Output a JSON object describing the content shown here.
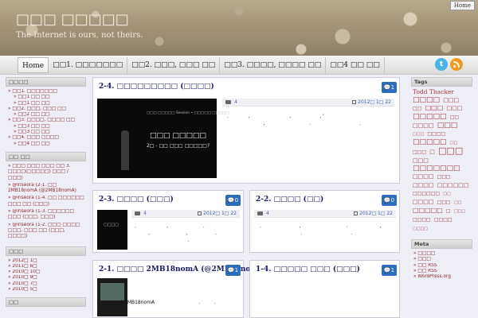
{
  "header": {
    "site_title": "□□□ □□□□□",
    "tagline": "The Internet is ours, not theirs.",
    "home_button": "Home"
  },
  "nav": {
    "items": [
      "Home",
      "□□1. □□□□□□□",
      "□□2. □□□, □□□ □□",
      "□□3. □□□□, □□□□ □□",
      "□□4 □□ □□"
    ],
    "twitter_icon": "twitter-icon",
    "rss_icon": "rss-icon"
  },
  "sidebar_left": {
    "categories": {
      "title": "□□□□",
      "items": [
        {
          "label": "□□1. □□□□□□□",
          "sub": false
        },
        {
          "label": "□□1 □□ □□",
          "sub": true
        },
        {
          "label": "□□1 □□ □□",
          "sub": true
        },
        {
          "label": "□□2. □□□, □□□ □□",
          "sub": false
        },
        {
          "label": "□□2 □□ □□",
          "sub": true
        },
        {
          "label": "□□3. □□□□, □□□□ □□",
          "sub": false
        },
        {
          "label": "□□3 □□ □□",
          "sub": true
        },
        {
          "label": "□□3 □□ □□",
          "sub": true
        },
        {
          "label": "□□4. □□□ □□□□",
          "sub": false
        },
        {
          "label": "□□4 □□ □□",
          "sub": true
        }
      ]
    },
    "recent_comments": {
      "title": "□□ □□",
      "items": [
        "□□□ □□□ □□□ □□ 3. □□□□(□□□□□) □□□ / □□□)",
        "@iriseora (2-1. □□ 2MB18nomA (@2MB18nomA)",
        "@iriseora (1-4. □□ □□□□□□ □□□ □□ (□□□)",
        "@iriseora (1-3. □□□□□□ □□□ (□□□, □□□)",
        "@iriseora (1-2. □□□ □□□□ □□□, □□□ □□ (□□□, □□□□)"
      ]
    },
    "archives": {
      "title": "□□□",
      "items": [
        "2012□ 1□",
        "2011□ 6□",
        "2010□ 10□",
        "2010□ 9□",
        "2010□ 7□",
        "2010□ 5□"
      ]
    },
    "more": {
      "title": "□□"
    }
  },
  "sidebar_right": {
    "tags": {
      "title": "Tags",
      "words": [
        {
          "t": "Todd Thacker",
          "s": 7.5
        },
        {
          "t": "□□□□",
          "s": 9
        },
        {
          "t": "□□□",
          "s": 7
        },
        {
          "t": "□□",
          "s": 6
        },
        {
          "t": "□□□",
          "s": 8
        },
        {
          "t": "□□□",
          "s": 7
        },
        {
          "t": "□□□□□",
          "s": 9
        },
        {
          "t": "□□",
          "s": 6
        },
        {
          "t": "□□□□",
          "s": 7
        },
        {
          "t": "□□□",
          "s": 9
        },
        {
          "t": "□□□",
          "s": 5
        },
        {
          "t": "□□□□",
          "s": 6
        },
        {
          "t": "□□□□□",
          "s": 9
        },
        {
          "t": "□□",
          "s": 5
        },
        {
          "t": "□□□",
          "s": 6
        },
        {
          "t": "□",
          "s": 7
        },
        {
          "t": "□□□",
          "s": 11
        },
        {
          "t": "□□□",
          "s": 7
        },
        {
          "t": "□□□□□□□",
          "s": 9
        },
        {
          "t": "□□□□",
          "s": 7
        },
        {
          "t": "□□□",
          "s": 6
        },
        {
          "t": "□□□□",
          "s": 7
        },
        {
          "t": "□□□□□□",
          "s": 7
        },
        {
          "t": "□□□□□□",
          "s": 6
        },
        {
          "t": "□□",
          "s": 5
        },
        {
          "t": "□□□□",
          "s": 7
        },
        {
          "t": "□□□",
          "s": 6
        },
        {
          "t": "□□",
          "s": 5
        },
        {
          "t": "□□□□□",
          "s": 8
        },
        {
          "t": "□",
          "s": 6
        },
        {
          "t": "□□□",
          "s": 5
        },
        {
          "t": "□□□□",
          "s": 6
        },
        {
          "t": "□□□□",
          "s": 6
        },
        {
          "t": "□□□□",
          "s": 5
        }
      ]
    },
    "meta": {
      "title": "Meta",
      "items": [
        "□□□□",
        "□□□",
        "□□ RSS",
        "□□ RSS",
        "WordPress.org"
      ]
    }
  },
  "posts": [
    {
      "title": "2-4. □□□□□□□□□ (□□□□)",
      "comments": "1",
      "category": "4",
      "date": "2012□ 1□ 22",
      "slide_line1": "□□□ □□□□□ Session • □□□□□ □□□□□",
      "slide_line2": "□□□ □□□□□",
      "slide_line3": "2□ - □□ □□□ □□□□□?"
    },
    {
      "title": "2-3. □□□□ (□□□)",
      "comments": "0",
      "category": "4",
      "date": "2012□ 1□ 22",
      "thumb_text": "□□□□"
    },
    {
      "title": "2-2. □□□□ (□□)",
      "comments": "0",
      "category": "4",
      "date": "2012□ 1□ 22"
    },
    {
      "title": "2-1. □□□□ 2MB18nomA (@2MB18nomA)",
      "comments": "1",
      "excerpt": "@2MB18nomA"
    },
    {
      "title": "1-4. □□□□□ □□□ (□□□)",
      "comments": "1"
    }
  ]
}
